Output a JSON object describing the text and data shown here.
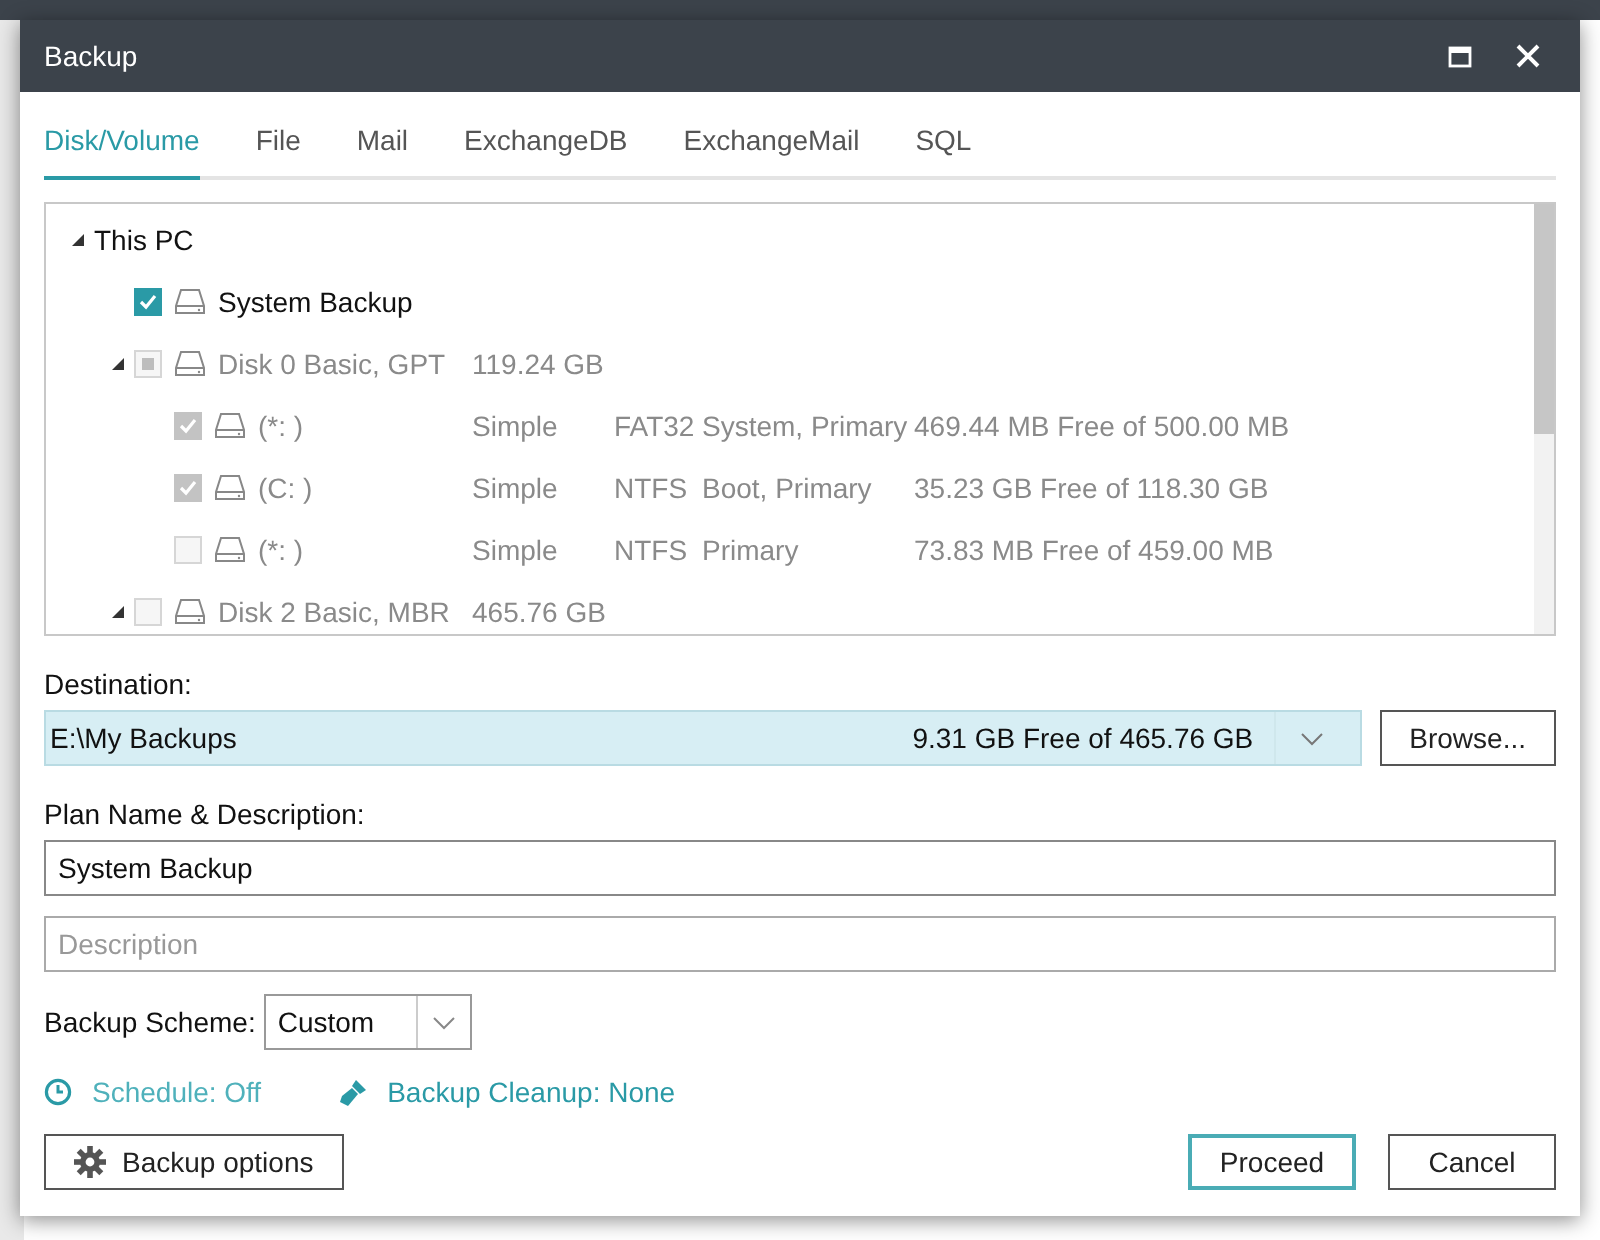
{
  "window": {
    "title": "Backup"
  },
  "tabs": [
    {
      "label": "Disk/Volume",
      "selected": true
    },
    {
      "label": "File",
      "selected": false
    },
    {
      "label": "Mail",
      "selected": false
    },
    {
      "label": "ExchangeDB",
      "selected": false
    },
    {
      "label": "ExchangeMail",
      "selected": false
    },
    {
      "label": "SQL",
      "selected": false
    }
  ],
  "tree": [
    {
      "label": "This PC",
      "expanded": true,
      "children": [
        {
          "label": "System Backup",
          "checked": true,
          "disabled": false
        },
        {
          "label": "Disk 0 Basic, GPT",
          "size": "119.24 GB",
          "checked": false,
          "partial": true,
          "disabled": true,
          "expanded": true,
          "children": [
            {
              "label": "(*: )",
              "type": "Simple",
              "file_system": "FAT32",
              "flags": "System, Primary",
              "free": "469.44 MB Free of 500.00 MB",
              "checked": true,
              "disabled": true
            },
            {
              "label": "(C: )",
              "type": "Simple",
              "file_system": "NTFS",
              "flags": "Boot, Primary",
              "free": "35.23 GB Free of 118.30 GB",
              "checked": true,
              "disabled": true
            },
            {
              "label": "(*: )",
              "type": "Simple",
              "file_system": "NTFS",
              "flags": "Primary",
              "free": "73.83 MB Free of 459.00 MB",
              "checked": false,
              "disabled": true
            }
          ]
        },
        {
          "label": "Disk 2 Basic, MBR",
          "size": "465.76 GB",
          "checked": false,
          "disabled": true,
          "expanded": true
        }
      ]
    }
  ],
  "destination": {
    "label": "Destination:",
    "value": "E:\\My Backups",
    "free": "9.31 GB Free of 465.76 GB",
    "browse": "Browse..."
  },
  "plan": {
    "label": "Plan Name & Description:",
    "name_value": "System Backup",
    "description_placeholder": "Description"
  },
  "scheme": {
    "label": "Backup Scheme:",
    "value": "Custom"
  },
  "schedule": "Schedule: Off",
  "cleanup": "Backup Cleanup: None",
  "buttons": {
    "options": "Backup options",
    "proceed": "Proceed",
    "cancel": "Cancel"
  }
}
